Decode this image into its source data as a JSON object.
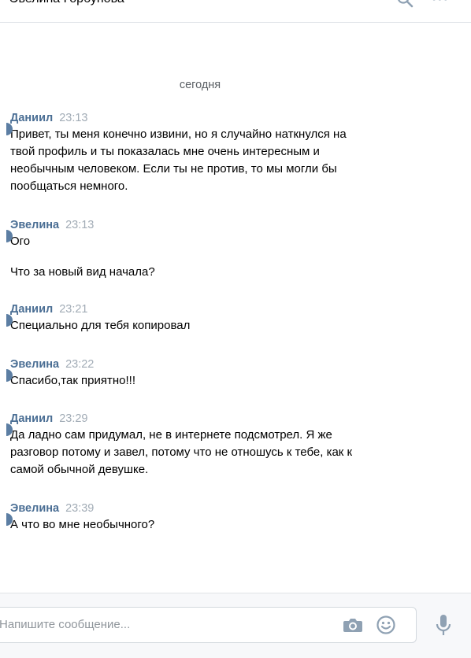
{
  "header": {
    "title": "Эвелина Горбунова",
    "more_label": "•••"
  },
  "date_separator": "сегодня",
  "messages": [
    {
      "author": "Даниил",
      "time": "23:13",
      "text": "Привет, ты меня конечно извини, но я случайно наткнулся на\nтвой профиль и ты показалась мне очень интересным и\nнеобычным человеком. Если ты не против, то мы могли бы\nпообщаться немного."
    },
    {
      "author": "Эвелина",
      "time": "23:13",
      "text": "Ого"
    },
    {
      "author": "",
      "time": "",
      "text": "Что за новый вид начала?"
    },
    {
      "author": "Даниил",
      "time": "23:21",
      "text": "Специально для тебя копировал"
    },
    {
      "author": "Эвелина",
      "time": "23:22",
      "text": "Спасибо,так приятно!!!"
    },
    {
      "author": "Даниил",
      "time": "23:29",
      "text": "Да ладно сам придумал, не в интернете подсмотрел. Я же\nразговор потому и завел, потому что не отношусь к тебе, как к\nсамой обычной девушке."
    },
    {
      "author": "Эвелина",
      "time": "23:39",
      "text": "А что во мне необычного?"
    }
  ],
  "composer": {
    "placeholder": "Напишите сообщение..."
  },
  "icons": {
    "header": [
      "search-icon",
      "more-icon"
    ],
    "composer": [
      "camera-icon",
      "emoji-icon",
      "microphone-icon"
    ]
  },
  "colors": {
    "author": "#4a6e94",
    "time": "#a2acb6",
    "icon": "#8fa1b3",
    "composer_bg": "#f7f8fa"
  }
}
